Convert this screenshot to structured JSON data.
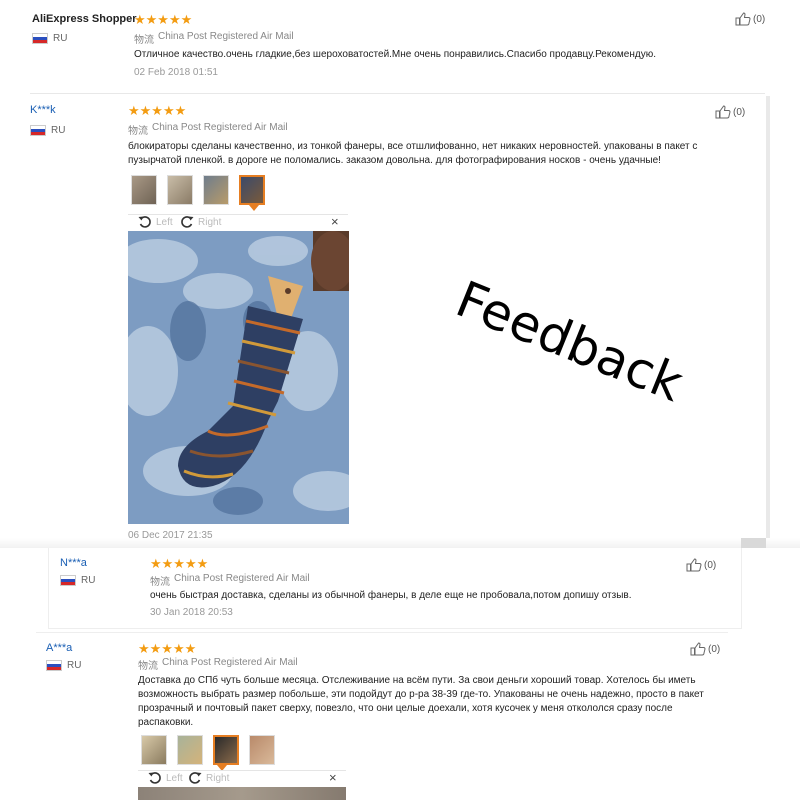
{
  "reviews": [
    {
      "user": "AliExpress Shopper",
      "country": "RU",
      "shipping_label": "物流",
      "shipping_method": "China Post Registered Air Mail",
      "text": "Отличное качество.очень гладкие,без шероховатостей.Мне очень понравились.Спасибо продавцу.Рекомендую.",
      "date": "02 Feb 2018 01:51",
      "helpful": "(0)",
      "rating_stars": "★★★★★",
      "rating": 5
    },
    {
      "user": "K***k",
      "country": "RU",
      "shipping_label": "物流",
      "shipping_method": "China Post Registered Air Mail",
      "text_line1": "блокираторы сделаны качественно, из тонкой фанеры, все отшлифованно, нет никаких неровностей. упакованы в пакет с",
      "text_line2": "пузырчатой пленкой. в дороге не поломались. заказом довольна. для фотографирования носков - очень удачные!",
      "date": "06 Dec 2017 21:35",
      "helpful": "(0)",
      "rating_stars": "★★★★★",
      "rating": 5,
      "viewer": {
        "left": "Left",
        "right": "Right",
        "close": "×"
      }
    },
    {
      "user": "N***a",
      "country": "RU",
      "shipping_label": "物流",
      "shipping_method": "China Post Registered Air Mail",
      "text": "очень быстрая доставка, сделаны из обычной фанеры, в деле еще не пробовала,потом допишу отзыв.",
      "date": "30 Jan 2018 20:53",
      "helpful": "(0)",
      "rating_stars": "★★★★★",
      "rating": 5
    },
    {
      "user": "A***a",
      "country": "RU",
      "shipping_label": "物流",
      "shipping_method": "China Post Registered Air Mail",
      "text_line1": "Доставка до СПб чуть больше месяца. Отслеживание на всём пути. За свои деньги хороший товар. Хотелось бы иметь",
      "text_line2": "возможность выбрать размер побольше, эти подойдут до р-ра 38-39 где-то. Упакованы не очень надежно, просто в пакет",
      "text_line3": "прозрачный и почтовый пакет сверху, повезло, что они целые доехали, хотя кусочек у меня откололся сразу после",
      "text_line4": "распаковки.",
      "helpful": "(0)",
      "rating_stars": "★★★★★",
      "rating": 5,
      "viewer": {
        "left": "Left",
        "right": "Right",
        "close": "×"
      }
    }
  ],
  "overlay_text": "Feedback",
  "colors": {
    "star": "#f39c12",
    "link": "#1a5fb4",
    "active_thumb": "#e67e22"
  }
}
